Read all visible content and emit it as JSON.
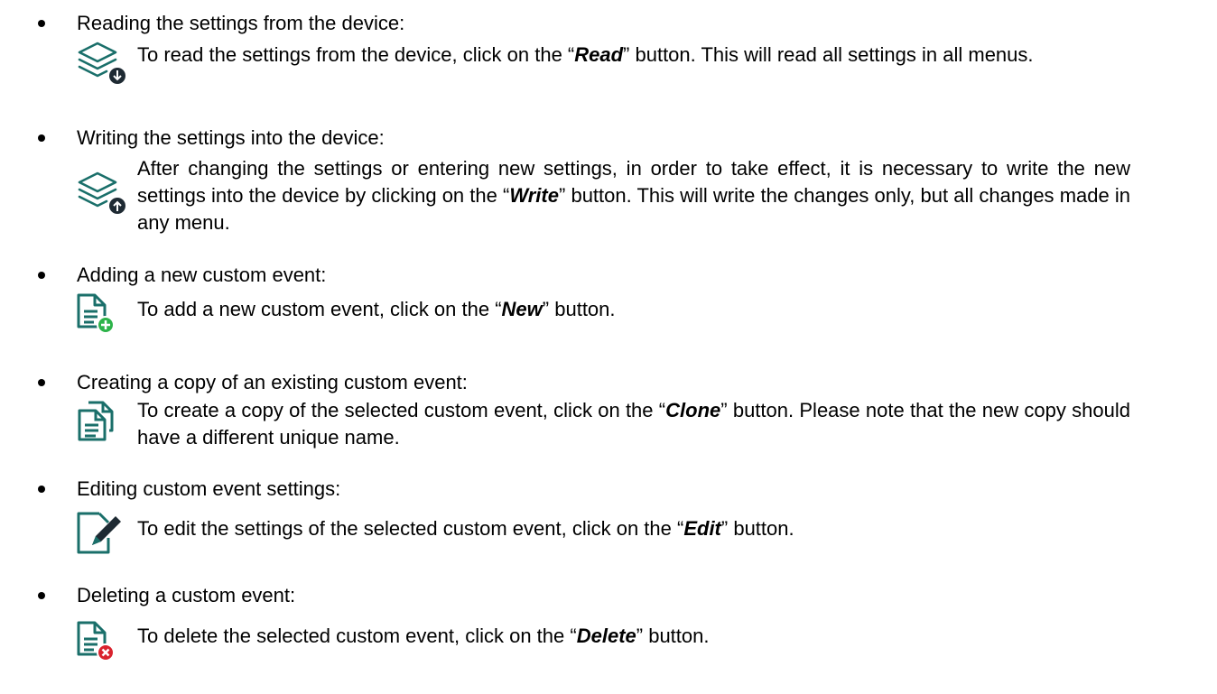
{
  "items": [
    {
      "heading": "Reading the settings from the device:",
      "icon": "layers-download-icon",
      "pre": "To read the settings from the device, click on the “",
      "button": "Read",
      "post": "” button. This will read all settings in all menus."
    },
    {
      "heading": "Writing the settings into the device:",
      "icon": "layers-upload-icon",
      "pre": "After changing the settings or entering new settings, in order to take effect, it is necessary to write the new settings into the device by clicking on the “",
      "button": "Write",
      "post": "” button. This will write the changes only, but all changes made in any menu."
    },
    {
      "heading": "Adding a new custom event:",
      "icon": "document-add-icon",
      "pre": "To add a new custom event, click on the “",
      "button": "New",
      "post": "” button."
    },
    {
      "heading": "Creating a copy of an existing custom event:",
      "icon": "document-clone-icon",
      "pre": "To create a copy of the selected custom event, click on the “",
      "button": "Clone",
      "post": "” button. Please note that the new copy should have a different unique name."
    },
    {
      "heading": "Editing custom event settings:",
      "icon": "document-edit-icon",
      "pre": "To edit the settings of the selected custom event, click on the “",
      "button": "Edit",
      "post": "” button."
    },
    {
      "heading": "Deleting a custom event:",
      "icon": "document-delete-icon",
      "pre": "To delete the selected custom event, click on the “",
      "button": "Delete",
      "post": "” button."
    }
  ],
  "colors": {
    "icon_teal": "#1a6f6a",
    "icon_dark": "#1e2a33",
    "add_green": "#2db34a",
    "delete_red": "#d9232e"
  }
}
